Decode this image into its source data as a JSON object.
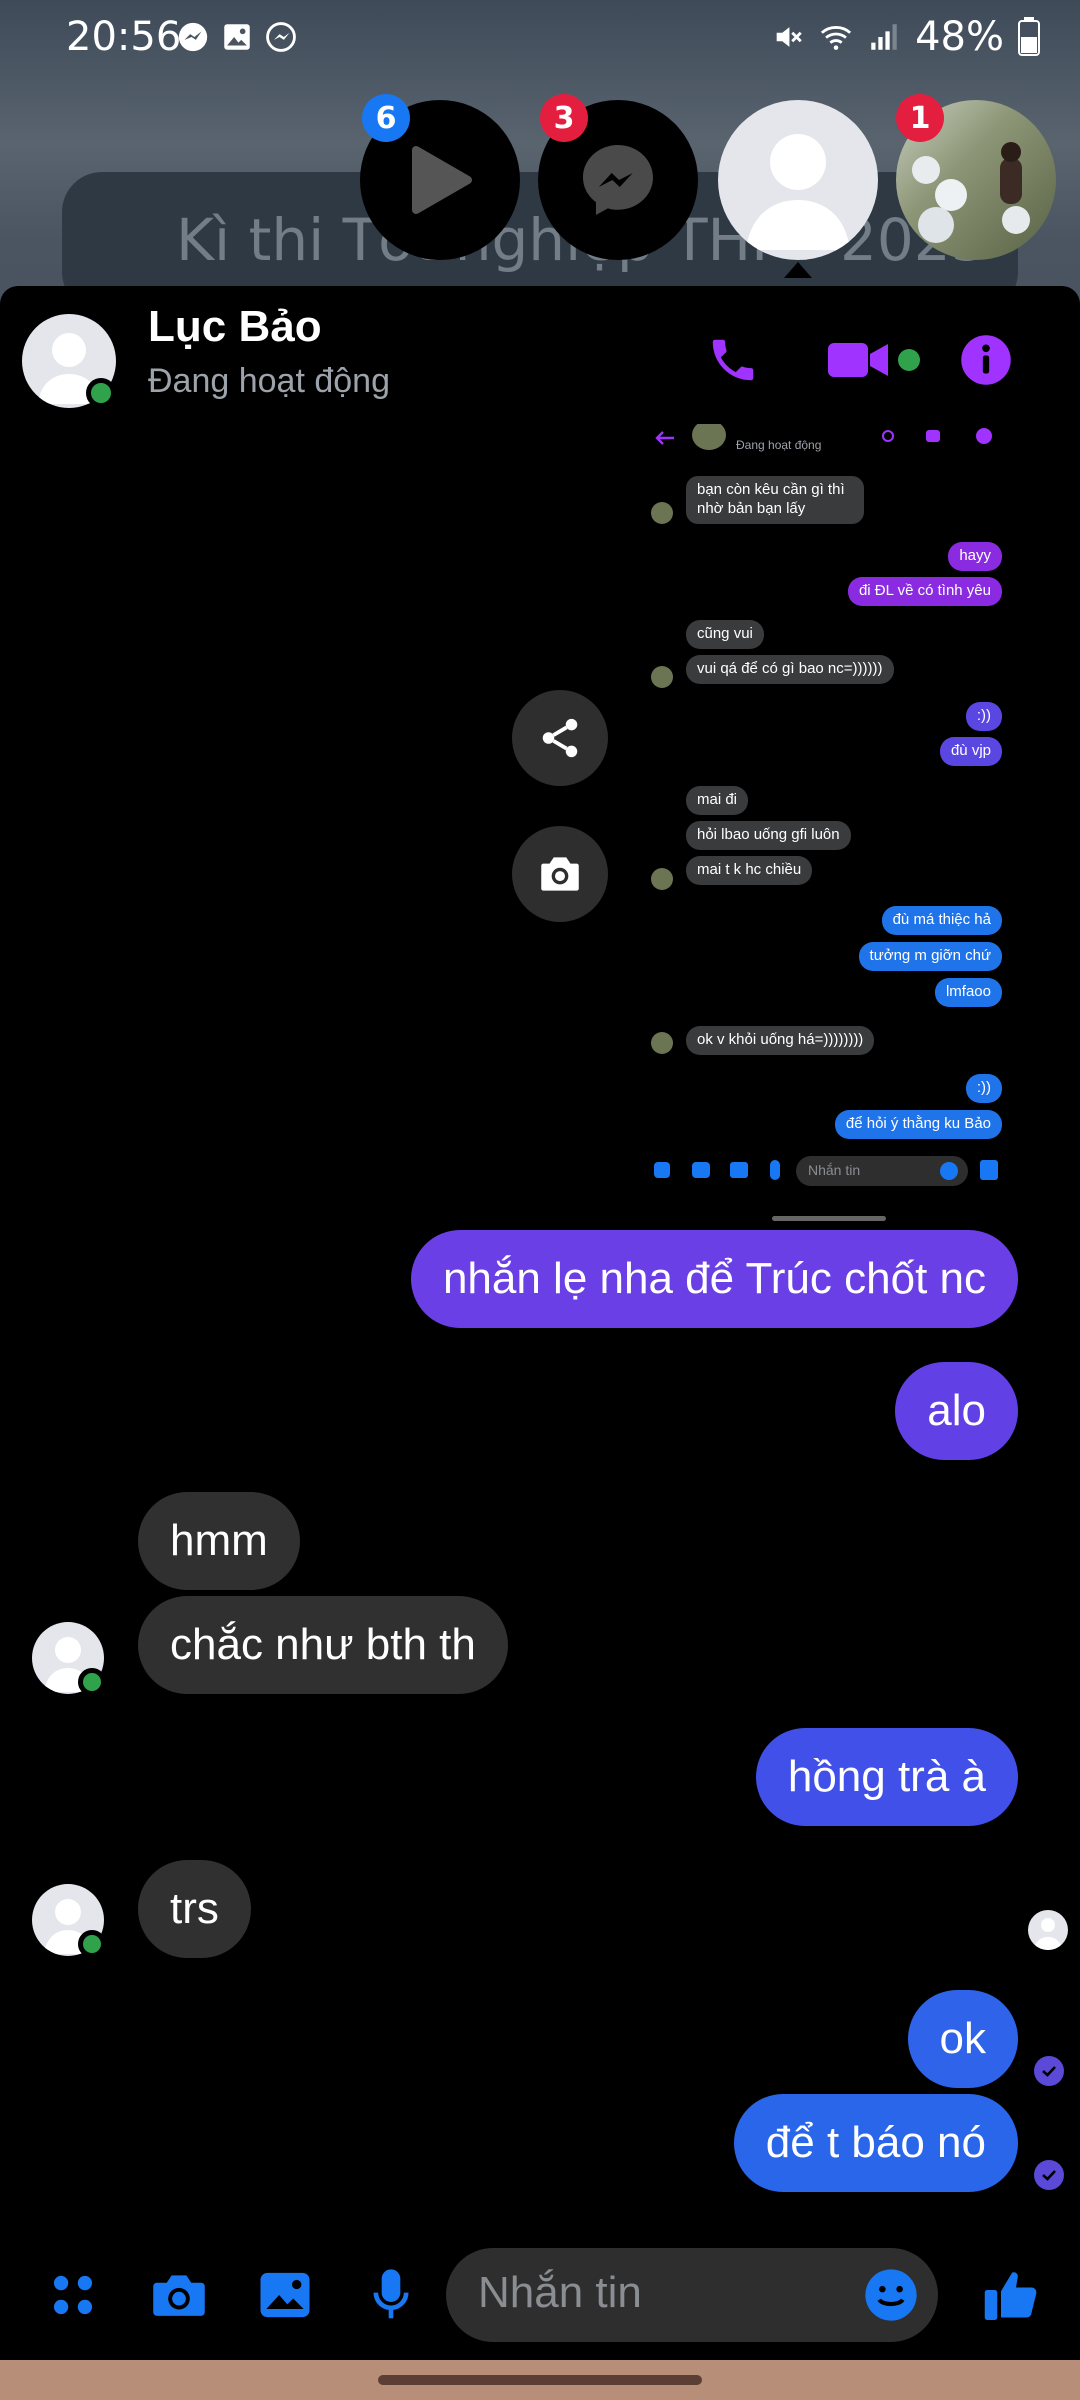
{
  "status_bar": {
    "time": "20:56",
    "battery": "48%",
    "left_icons": [
      "messenger-icon",
      "gallery-icon",
      "messenger-icon"
    ],
    "right_icons": [
      "mute-icon",
      "wifi-icon",
      "signal-icon",
      "battery-icon"
    ]
  },
  "background_notification": {
    "text": "Kì thi Tốt nghiệp THPT 2023"
  },
  "chat_heads": [
    {
      "name": "video-player-chathead",
      "badge": "6",
      "badge_color": "#1877f2"
    },
    {
      "name": "messenger-chathead",
      "badge": "3",
      "badge_color": "#e41e3f"
    },
    {
      "name": "contact-chathead",
      "badge": "",
      "badge_color": ""
    },
    {
      "name": "photo-contact-chathead",
      "badge": "1",
      "badge_color": "#e41e3f"
    }
  ],
  "header": {
    "name": "Lục Bảo",
    "status": "Đang hoạt động",
    "accent_color": "#a033ff"
  },
  "embedded_screenshot": {
    "header_status": "Đang hoạt động",
    "messages": [
      {
        "text": "bạn còn kêu cần gì thì nhờ bản bạn",
        "side": "in"
      },
      {
        "text": "lấy",
        "side": "in"
      },
      {
        "text": "hayy",
        "side": "out"
      },
      {
        "text": "đi ĐL về có tình yêu",
        "side": "out"
      },
      {
        "text": "cũng vui",
        "side": "in"
      },
      {
        "text": "vui qá để có gì bao nc=))))))",
        "side": "in"
      },
      {
        "text": ":))",
        "side": "out"
      },
      {
        "text": "đù vjp",
        "side": "out"
      },
      {
        "text": "mai đi",
        "side": "in"
      },
      {
        "text": "hỏi lbao uống gfi luôn",
        "side": "in"
      },
      {
        "text": "mai t k hc chiều",
        "side": "in"
      },
      {
        "text": "đù má thiệc hả",
        "side": "out"
      },
      {
        "text": "tưởng m giỡn chứ",
        "side": "out"
      },
      {
        "text": "lmfaoo",
        "side": "out"
      },
      {
        "text": "ok v khỏi uống há=))))))))",
        "side": "in"
      },
      {
        "text": ":))",
        "side": "out"
      },
      {
        "text": "để hỏi ý thằng ku Bảo",
        "side": "out"
      }
    ],
    "composer_placeholder": "Nhắn tin"
  },
  "messages": [
    {
      "text": "nhắn lẹ nha để Trúc chốt nc",
      "side": "out",
      "color": "#6a3fe6"
    },
    {
      "text": "alo",
      "side": "out",
      "color": "#6140e6"
    },
    {
      "text": "hmm",
      "side": "in"
    },
    {
      "text": "chắc như bth th",
      "side": "in"
    },
    {
      "text": "hồng trà à",
      "side": "out",
      "color": "#4050e8"
    },
    {
      "text": "trs",
      "side": "in"
    },
    {
      "text": "ok",
      "side": "out",
      "color": "#2f63ea"
    },
    {
      "text": "để t báo nó",
      "side": "out",
      "color": "#2a66ea"
    }
  ],
  "composer": {
    "placeholder": "Nhắn tin",
    "icon_color": "#1877f2"
  }
}
